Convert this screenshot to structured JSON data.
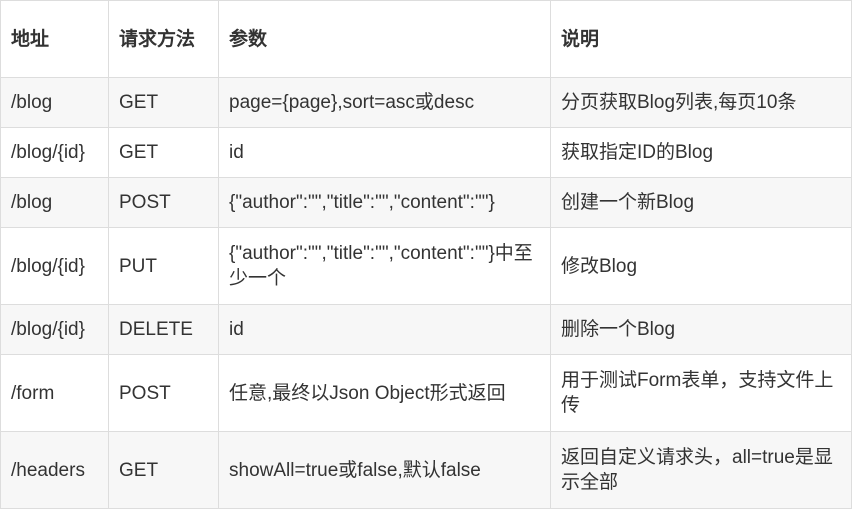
{
  "headers": {
    "address": "地址",
    "method": "请求方法",
    "params": "参数",
    "description": "说明"
  },
  "rows": [
    {
      "address": "/blog",
      "method": "GET",
      "params": "page={page},sort=asc或desc",
      "description": "分页获取Blog列表,每页10条"
    },
    {
      "address": "/blog/{id}",
      "method": "GET",
      "params": "id",
      "description": "获取指定ID的Blog"
    },
    {
      "address": "/blog",
      "method": "POST",
      "params": "{\"author\":\"\",\"title\":\"\",\"content\":\"\"}",
      "description": "创建一个新Blog"
    },
    {
      "address": "/blog/{id}",
      "method": "PUT",
      "params": "{\"author\":\"\",\"title\":\"\",\"content\":\"\"}中至少一个",
      "description": "修改Blog"
    },
    {
      "address": "/blog/{id}",
      "method": "DELETE",
      "params": "id",
      "description": "删除一个Blog"
    },
    {
      "address": "/form",
      "method": "POST",
      "params": "任意,最终以Json Object形式返回",
      "description": "用于测试Form表单，支持文件上传"
    },
    {
      "address": "/headers",
      "method": "GET",
      "params": "showAll=true或false,默认false",
      "description": "返回自定义请求头，all=true是显示全部"
    }
  ]
}
